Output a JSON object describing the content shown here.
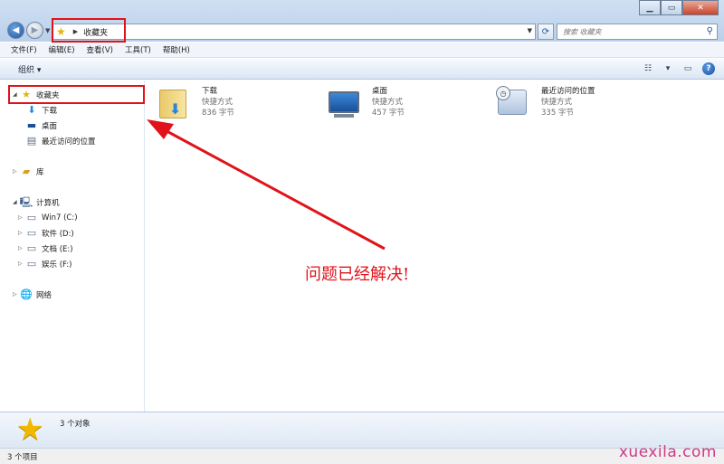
{
  "address_bar": {
    "current_location": "收藏夹"
  },
  "search": {
    "placeholder": "搜索 收藏夹"
  },
  "menubar": {
    "items": [
      "文件(F)",
      "编辑(E)",
      "查看(V)",
      "工具(T)",
      "帮助(H)"
    ]
  },
  "commandbar": {
    "organize_label": "组织 ▾"
  },
  "sidebar": {
    "favorites": {
      "label": "收藏夹",
      "children": [
        "下载",
        "桌面",
        "最近访问的位置"
      ]
    },
    "libraries": {
      "label": "库"
    },
    "computer": {
      "label": "计算机",
      "drives": [
        "Win7 (C:)",
        "软件 (D:)",
        "文档 (E:)",
        "娱乐 (F:)"
      ]
    },
    "network": {
      "label": "网络"
    }
  },
  "content": {
    "items": [
      {
        "name": "下载",
        "type": "快捷方式",
        "size": "836 字节",
        "icon": "folder-download-icon"
      },
      {
        "name": "桌面",
        "type": "快捷方式",
        "size": "457 字节",
        "icon": "desktop-icon"
      },
      {
        "name": "最近访问的位置",
        "type": "快捷方式",
        "size": "335 字节",
        "icon": "recent-places-icon"
      }
    ]
  },
  "details_pane": {
    "count_text": "3 个对象"
  },
  "statusbar": {
    "text": "3 个项目"
  },
  "annotation": {
    "text": "问题已经解决!",
    "color": "#e0131a"
  },
  "watermark": "xuexila.com"
}
